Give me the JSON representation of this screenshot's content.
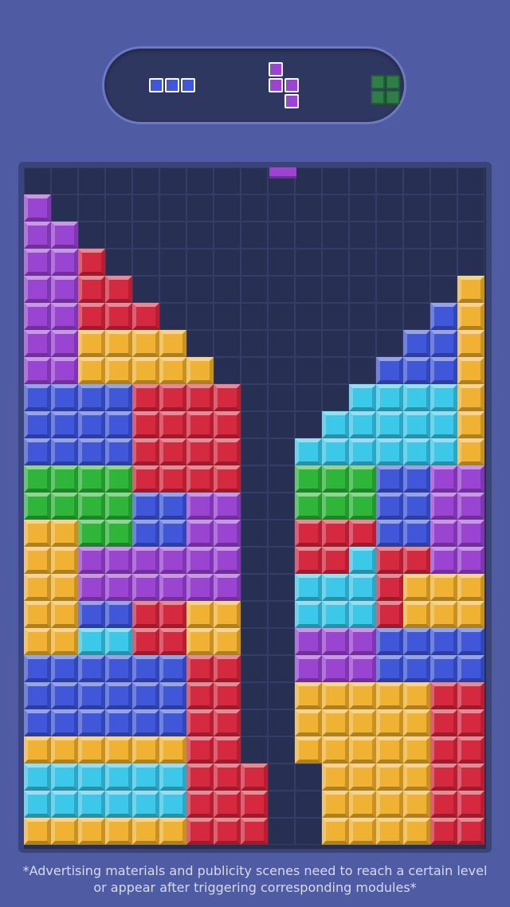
{
  "colors": {
    "P": "#9a44d2",
    "R": "#d5293f",
    "Y": "#f0b232",
    "B": "#3f57d8",
    "C": "#3cc8e8",
    "G": "#2fb63a",
    "empty": "#272f52",
    "grid_line": "#343d66"
  },
  "next_pieces": [
    {
      "name": "I-piece",
      "color": "#3f57d8"
    },
    {
      "name": "S-piece",
      "color": "#9a44d2"
    },
    {
      "name": "O-piece",
      "color": "#2f7e48"
    }
  ],
  "board": {
    "columns": 17,
    "rows": 25,
    "grid": [
      ".................",
      "P................",
      "PP...............",
      "PPR..............",
      "PPRR............Y",
      "PPRRR..........BY",
      "PPYYYY........BBY",
      "PPYYYYY......BBBY",
      "BBBBRRRR....CCCCY",
      "BBBBRRRR...CCCCCY",
      "BBBBRRRR..CCCCCCY",
      "GGGGRRRR..GGGBBPP",
      "GGGGBBPP..GGGBBPP",
      "YYGGBBPP..RRRBBPP",
      "YYPPPPPP..RRCRRPP",
      "YYPPPPPP..CCCRYYY",
      "YYBBRRYY..CCCRYYY",
      "YYCCRRYY..PPPBBBB",
      "BBBBBBRR..PPPBBBB",
      "BBBBBBRR..YYYYYRR",
      "BBBBBBRR..YYYYYRR",
      "YYYYYYRR..YYYYYRR",
      "CCCCCCRRR..YYYYRR",
      "CCCCCCRRR..YYYYRR",
      "YYYYYYRRR..YYYYRR"
    ],
    "falling_piece_color": "#9a44d2"
  },
  "disclaimer_line1": "*Advertising materials and publicity scenes need to reach a certain level",
  "disclaimer_line2": "or appear after triggering corresponding modules*"
}
